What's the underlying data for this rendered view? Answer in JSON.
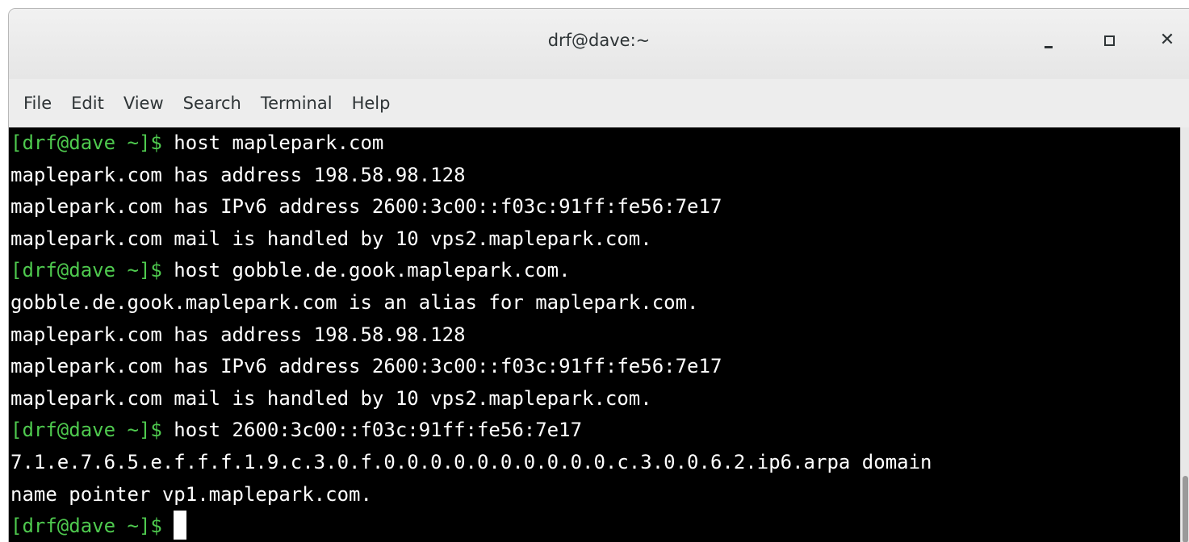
{
  "window": {
    "title": "drf@dave:~",
    "controls": {
      "minimize_icon": "minimize-icon",
      "maximize_icon": "maximize-icon",
      "close_icon": "close-icon"
    }
  },
  "menubar": {
    "items": [
      "File",
      "Edit",
      "View",
      "Search",
      "Terminal",
      "Help"
    ]
  },
  "terminal": {
    "colors": {
      "background": "#000000",
      "foreground": "#ffffff",
      "prompt": "#4ec94e"
    },
    "lines": [
      {
        "prompt": "[drf@dave ~]$ ",
        "text": "host maplepark.com"
      },
      {
        "prompt": "",
        "text": "maplepark.com has address 198.58.98.128"
      },
      {
        "prompt": "",
        "text": "maplepark.com has IPv6 address 2600:3c00::f03c:91ff:fe56:7e17"
      },
      {
        "prompt": "",
        "text": "maplepark.com mail is handled by 10 vps2.maplepark.com."
      },
      {
        "prompt": "[drf@dave ~]$ ",
        "text": "host gobble.de.gook.maplepark.com."
      },
      {
        "prompt": "",
        "text": "gobble.de.gook.maplepark.com is an alias for maplepark.com."
      },
      {
        "prompt": "",
        "text": "maplepark.com has address 198.58.98.128"
      },
      {
        "prompt": "",
        "text": "maplepark.com has IPv6 address 2600:3c00::f03c:91ff:fe56:7e17"
      },
      {
        "prompt": "",
        "text": "maplepark.com mail is handled by 10 vps2.maplepark.com."
      },
      {
        "prompt": "[drf@dave ~]$ ",
        "text": "host 2600:3c00::f03c:91ff:fe56:7e17"
      },
      {
        "prompt": "",
        "text": "7.1.e.7.6.5.e.f.f.f.1.9.c.3.0.f.0.0.0.0.0.0.0.0.0.0.c.3.0.0.6.2.ip6.arpa domain"
      },
      {
        "prompt": "",
        "text": "name pointer vp1.maplepark.com."
      },
      {
        "prompt": "[drf@dave ~]$ ",
        "text": "",
        "cursor": true
      }
    ]
  }
}
